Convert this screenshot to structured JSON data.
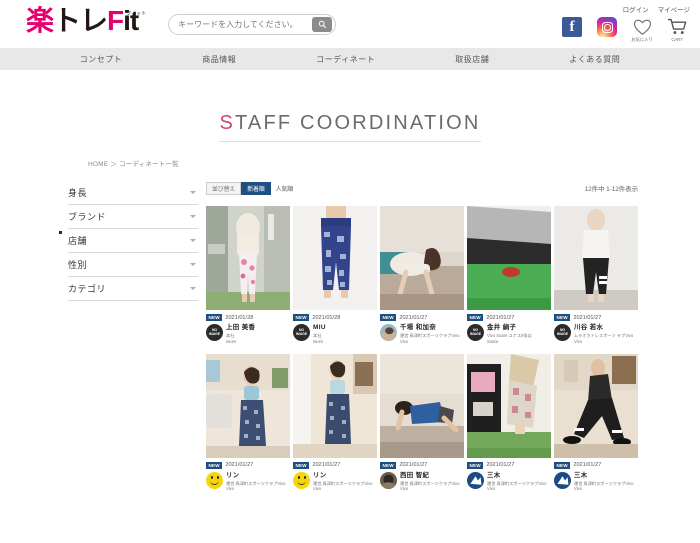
{
  "header": {
    "logo": {
      "part1": "楽",
      "part2": "トレ",
      "part3": "F",
      "part4": "it",
      "ruby": "フィット"
    },
    "search": {
      "placeholder": "キーワードを入力してください。",
      "value": "",
      "icon": "search-icon"
    },
    "top_links": [
      "ログイン",
      "マイページ"
    ],
    "social": [
      {
        "name": "facebook-icon",
        "glyph": "f"
      },
      {
        "name": "instagram-icon",
        "glyph": ""
      }
    ],
    "utility": [
      {
        "name": "favorite-icon",
        "caption": "お気に入り"
      },
      {
        "name": "cart-icon",
        "caption": "CART"
      }
    ]
  },
  "nav": {
    "items": [
      {
        "label": "コンセプト"
      },
      {
        "label": "商品情報"
      },
      {
        "label": "コーディネート"
      },
      {
        "label": "取扱店舗"
      },
      {
        "label": "よくある質問"
      }
    ]
  },
  "page": {
    "title_accent": "S",
    "title_rest": "TAFF COORDINATION",
    "breadcrumb": "HOME ＞ コーディネート一覧"
  },
  "sidebar": {
    "filters": [
      {
        "label": "身長"
      },
      {
        "label": "ブランド"
      },
      {
        "label": "店舗"
      },
      {
        "label": "性別"
      },
      {
        "label": "カテゴリ"
      }
    ]
  },
  "toolbar": {
    "sort_tabs": [
      {
        "label": "並び替え",
        "active": false,
        "plain": false
      },
      {
        "label": "新着順",
        "active": true,
        "plain": false
      },
      {
        "label": "人気順",
        "active": false,
        "plain": true
      }
    ],
    "result_count": "12件中 1-12件表示"
  },
  "colors": {
    "accent_pink": "#e5006e",
    "title_gray": "#6b6b6b",
    "badge_blue": "#1f4f82",
    "nav_bg": "#e8e8e8"
  },
  "cards": [
    {
      "badge": "NEW",
      "date": "2021/01/28",
      "name": "上田 美香",
      "store": "本社",
      "brand": "Iwom",
      "avatar": "no-image",
      "avatar_text": "NO IMAGE",
      "photo": "woman-floral-leggings"
    },
    {
      "badge": "NEW",
      "date": "2021/01/28",
      "name": "MIU",
      "store": "本社",
      "brand": "Iwom",
      "avatar": "no-image",
      "avatar_text": "NO IMAGE",
      "photo": "woman-blue-patterned-pants"
    },
    {
      "badge": "NEW",
      "date": "2021/01/27",
      "name": "千場 和加奈",
      "store": "運営 鳥津町スポーツクラブVivo",
      "brand": "Vivo",
      "avatar": "photo",
      "avatar_text": "",
      "photo": "woman-plank-pose"
    },
    {
      "badge": "NEW",
      "date": "2021/01/27",
      "name": "金井 絹子",
      "store": "Vivo Soare ユナス9条店",
      "brand": "Soare",
      "avatar": "no-image",
      "avatar_text": "NO IMAGE",
      "photo": "gray-skirt-green-mat"
    },
    {
      "badge": "NEW",
      "date": "2021/01/27",
      "name": "川谷 若水",
      "store": "ムラオカトレスポーツ ラブVivo",
      "brand": "Vivo",
      "avatar": "no-image",
      "avatar_text": "NO IMAGE",
      "photo": "woman-white-top-black-leggings"
    },
    {
      "badge": "NEW",
      "date": "2021/01/27",
      "name": "リン",
      "store": "運営 鳥津町スポーツクラブVivo",
      "brand": "Vivo",
      "avatar": "smiley",
      "avatar_text": "",
      "photo": "woman-sofa-patterned-skirt"
    },
    {
      "badge": "NEW",
      "date": "2021/01/27",
      "name": "リン",
      "store": "運営 鳥津町スポーツクラブVivo",
      "brand": "Vivo",
      "avatar": "smiley",
      "avatar_text": "",
      "photo": "woman-mirror-wrap-pants"
    },
    {
      "badge": "NEW",
      "date": "2021/01/27",
      "name": "西田 智紀",
      "store": "運営 鳥津町スポーツクラブVivo",
      "brand": "Vivo",
      "avatar": "photo",
      "avatar_text": "",
      "photo": "man-blue-tank-plank"
    },
    {
      "badge": "NEW",
      "date": "2021/01/27",
      "name": "三木",
      "store": "運営 鳥津町スポーツクラブVivo",
      "brand": "Vivo",
      "avatar": "logo",
      "avatar_text": "",
      "photo": "patterned-leggings-turf"
    },
    {
      "badge": "NEW",
      "date": "2021/01/27",
      "name": "三木",
      "store": "運営 鳥津町スポーツクラブVivo",
      "brand": "Vivo",
      "avatar": "logo",
      "avatar_text": "",
      "photo": "man-black-outfit-lunge"
    }
  ]
}
